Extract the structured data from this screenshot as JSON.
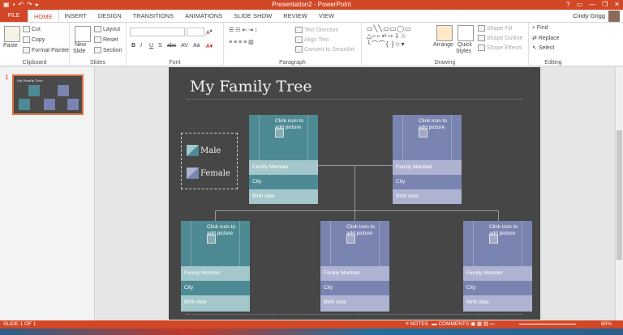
{
  "window": {
    "title": "Presentation2 - PowerPoint",
    "user": "Cindy Grigg",
    "controls": [
      "?",
      "□",
      "—",
      "□",
      "✕"
    ]
  },
  "tabs": {
    "file": "FILE",
    "items": [
      "HOME",
      "INSERT",
      "DESIGN",
      "TRANSITIONS",
      "ANIMATIONS",
      "SLIDE SHOW",
      "REVIEW",
      "VIEW"
    ],
    "active": "HOME"
  },
  "ribbon": {
    "clipboard": {
      "paste": "Paste",
      "cut": "Cut",
      "copy": "Copy",
      "format_painter": "Format Painter",
      "label": "Clipboard"
    },
    "slides": {
      "new_slide": "New",
      "new_slide2": "Slide",
      "layout": "Layout",
      "reset": "Reset",
      "section": "Section",
      "label": "Slides"
    },
    "font": {
      "bold": "B",
      "italic": "I",
      "underline": "U",
      "strike": "S",
      "abc": "abc",
      "spacing": "AV",
      "case": "Aa",
      "label": "Font"
    },
    "paragraph": {
      "text_direction": "Text Direction",
      "align_text": "Align Text",
      "convert": "Convert to SmartArt",
      "label": "Paragraph"
    },
    "drawing": {
      "arrange": "Arrange",
      "quick_styles": "Quick",
      "quick_styles2": "Styles",
      "shape_fill": "Shape Fill",
      "shape_outline": "Shape Outline",
      "shape_effects": "Shape Effects",
      "label": "Drawing"
    },
    "editing": {
      "find": "Find",
      "replace": "Replace",
      "select": "Select",
      "label": "Editing"
    }
  },
  "thumbnail": {
    "number": "1"
  },
  "slide": {
    "title": "My Family Tree",
    "legend": [
      {
        "label": "Male",
        "color": "#4e8a93"
      },
      {
        "label": "Female",
        "color": "#7a84b1"
      }
    ],
    "card_text": {
      "placeholder": "Click icon to add picture",
      "member": "Family Member",
      "city": "City",
      "birth": "Birth date"
    }
  },
  "colors": {
    "accent": "#d24726",
    "male_top": "#4e8a93",
    "male_row1": "#a4c7cc",
    "male_row2": "#4e8a93",
    "female_top": "#7a84b1",
    "female_row1": "#aeb3d2",
    "female_row2": "#7a84b1"
  },
  "status": {
    "slide": "SLIDE 1 OF 1",
    "notes": "NOTES",
    "comments": "COMMENTS",
    "zoom": "80%"
  }
}
